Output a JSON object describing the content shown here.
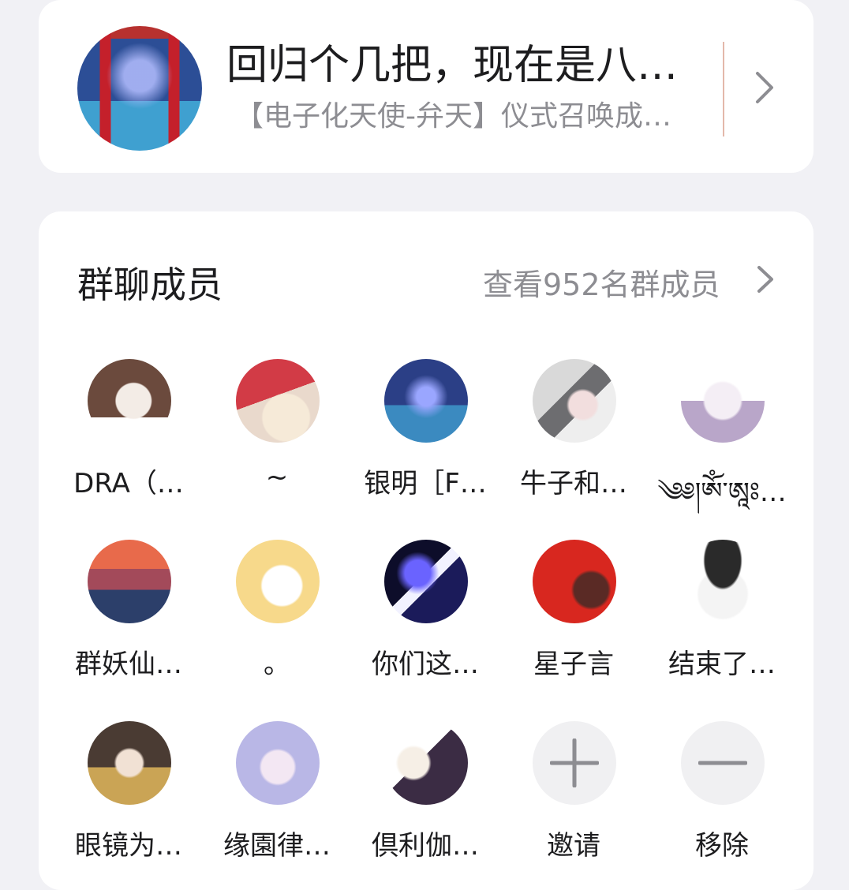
{
  "group": {
    "name": "回归个几把，现在是八…",
    "subtitle": "【电子化天使-弁天】仪式召唤成…"
  },
  "members_section": {
    "title": "群聊成员",
    "view_all": "查看952名群成员"
  },
  "members": [
    {
      "name": "DRA（…",
      "avatar": "doll-photo-avatar"
    },
    {
      "name": "~",
      "avatar": "red-hair-anime-avatar"
    },
    {
      "name": "银明［F…",
      "avatar": "mecha-angel-avatar"
    },
    {
      "name": "牛子和…",
      "avatar": "white-mecha-girl-avatar"
    },
    {
      "name": "༄༅།ཨོཾ་ཨཱཿ…",
      "avatar": "white-hair-horned-girl-avatar"
    },
    {
      "name": "群妖仙…",
      "avatar": "sunset-landscape-avatar"
    },
    {
      "name": "。",
      "avatar": "white-hair-boy-avatar"
    },
    {
      "name": "你们这…",
      "avatar": "blue-lineart-avatar"
    },
    {
      "name": "星子言",
      "avatar": "flag-portrait-avatar"
    },
    {
      "name": "结束了…",
      "avatar": "hamster-hat-avatar"
    },
    {
      "name": "眼镜为…",
      "avatar": "glasses-girl-avatar"
    },
    {
      "name": "缘園律…",
      "avatar": "lavender-hair-girl-avatar"
    },
    {
      "name": "倶利伽…",
      "avatar": "horned-fighter-avatar"
    }
  ],
  "actions": {
    "invite": "邀请",
    "remove": "移除"
  },
  "colors": {
    "background": "#f1f1f5",
    "card": "#ffffff",
    "primary_text": "#1d1d1f",
    "secondary_text": "#8d8d92",
    "divider": "#e3b8aa"
  }
}
